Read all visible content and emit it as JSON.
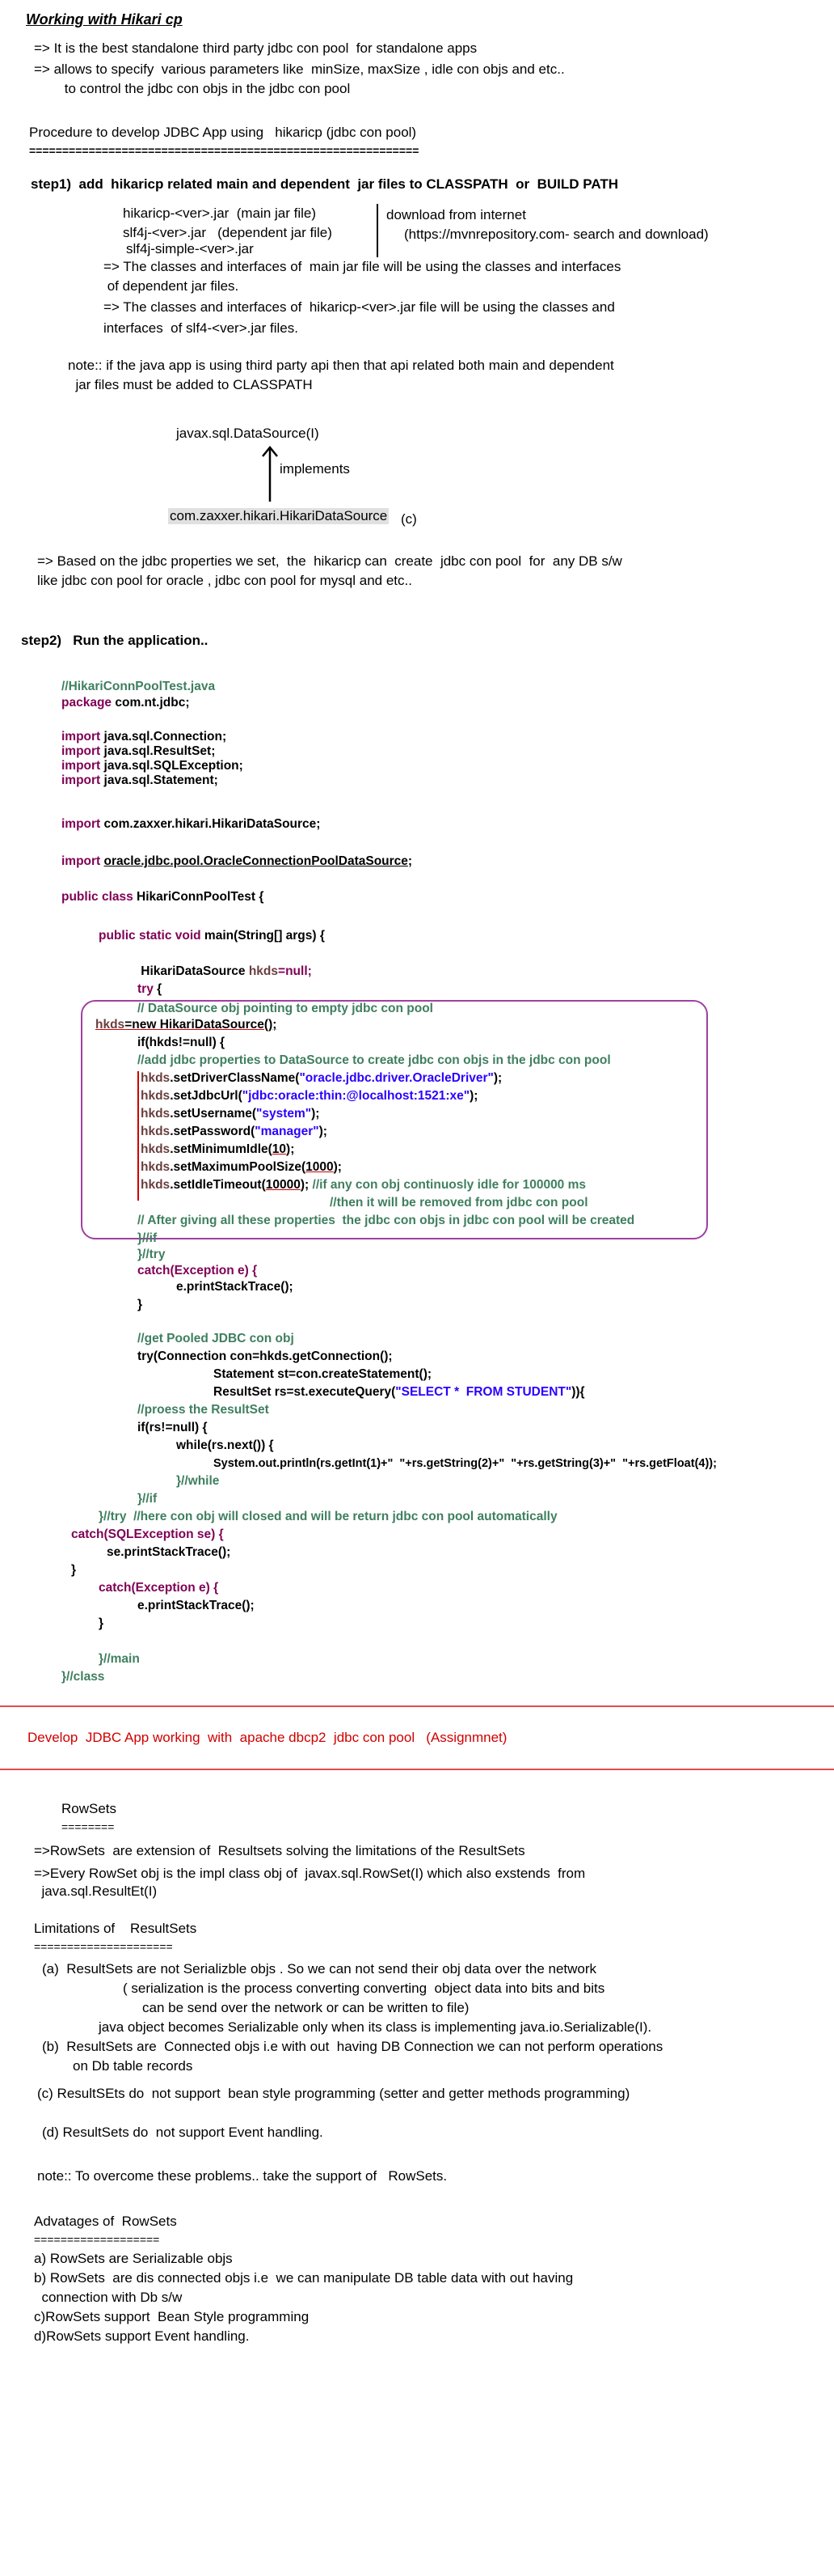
{
  "header": {
    "title": "Working with Hikari cp",
    "intro": [
      "=> It is the best standalone third party jdbc con pool  for standalone apps",
      "=> allows to specify  various parameters like  minSize, maxSize , idle con objs and etc..",
      "        to control the jdbc con objs in the jdbc con pool"
    ]
  },
  "procedure": {
    "heading": "Procedure to develop JDBC App using   hikaricp (jdbc con pool)",
    "rule": "===========================================================",
    "step1": "step1)  add  hikaricp related main and dependent  jar files to CLASSPATH  or  BUILD PATH",
    "jars": [
      "hikaricp-<ver>.jar  (main jar file)",
      "slf4j-<ver>.jar   (dependent jar file)",
      "slf4j-simple-<ver>.jar"
    ],
    "download": [
      "download from internet",
      "(https://mvnrepository.com- search and download)"
    ],
    "notes": [
      "=> The classes and interfaces of  main jar file will be using the classes and interfaces",
      " of dependent jar files.",
      "=> The classes and interfaces of  hikaricp-<ver>.jar file will be using the classes and",
      "interfaces  of slf4-<ver>.jar files."
    ],
    "note2": [
      "note:: if the java app is using third party api then that api related both main and dependent",
      "  jar files must be added to CLASSPATH"
    ],
    "diagram": {
      "interface": "javax.sql.DataSource(I)",
      "relation": "implements",
      "class": "com.zaxxer.hikari.HikariDataSource",
      "class_suffix": "(c)"
    },
    "summary": [
      "=> Based on the jdbc properties we set,  the  hikaricp can  create  jdbc con pool  for  any DB s/w",
      "like jdbc con pool for oracle , jdbc con pool for mysql and etc.."
    ],
    "step2": "step2)   Run the application.."
  },
  "code": {
    "file_comment": "//HikariConnPoolTest.java",
    "pkg_kw": "package",
    "pkg": " com.nt.jdbc;",
    "imp_kw": "import",
    "imports": [
      " java.sql.Connection;",
      " java.sql.ResultSet;",
      " java.sql.SQLException;",
      " java.sql.Statement;"
    ],
    "import_hikari": " com.zaxxer.hikari.HikariDataSource;",
    "import_oracle": "oracle.jdbc.pool.OracleConnectionPoolDataSource",
    "public_class": "public class",
    "class_name": " HikariConnPoolTest {",
    "main_kw": "public static void",
    "main_sig": " main(String[] args) {",
    "ds_type": " HikariDataSource ",
    "ds_var": "hkds",
    "eq_null": "=null;",
    "try_kw": "try",
    "brace": " {",
    "c_ds": "// DataSource obj pointing to empty jdbc con pool",
    "new_line_var": "hkds",
    "new_line_rest": "=new HikariDataSource();",
    "if_line": "if(hkds!=null) {",
    "c_add": "//add jdbc properties to DataSource to create jdbc con objs in the jdbc con pool",
    "set_driver": ".setDriverClassName(",
    "driver": "\"oracle.jdbc.driver.OracleDriver\"",
    "set_url": ".setJdbcUrl(",
    "url": "\"jdbc:oracle:thin:@localhost:1521:xe\"",
    "set_user": ".setUsername(",
    "user": "\"system\"",
    "set_pass": ".setPassword(",
    "pass": "\"manager\"",
    "set_min": ".setMinimumIdle(",
    "min": "10",
    "set_max": ".setMaximumPoolSize(",
    "max": "1000",
    "set_idle": ".setIdleTimeout(",
    "idle": "10000",
    "close_paren": ");",
    "c_idle1": " //if any con obj continuosly idle for 100000 ms",
    "c_idle2": "//then it will be removed from jdbc con pool",
    "c_after": "// After giving all these properties  the jdbc con objs in jdbc con pool will be created",
    "end_if": "}//if",
    "end_try": "}//try",
    "catch1": "catch(Exception e) {",
    "print1": "e.printStackTrace();",
    "close1": "}",
    "c_pooled": "//get Pooled JDBC con obj",
    "try2": "try(Connection con=hkds.getConnection();",
    "stmt_line": "Statement st=con.createStatement();",
    "rs_pre": "ResultSet rs=st.executeQuery(",
    "query": "\"SELECT *  FROM STUDENT\"",
    "rs_post": ")){",
    "c_process": "//proess the ResultSet",
    "if_rs": "if(rs!=null) {",
    "while_rs": "while(rs.next()) {",
    "println": "System.out.println(rs.getInt(1)+\"  \"+rs.getString(2)+\"  \"+rs.getString(3)+\"  \"+rs.getFloat(4));",
    "end_while": "}//while",
    "end_if2": "}//if",
    "end_try2": "}//try  //here con obj will closed and will be return jdbc con pool automatically",
    "catch_sql": "catch(SQLException se) {",
    "print_se": "se.printStackTrace();",
    "close2": "}",
    "catch_ex": "catch(Exception e) {",
    "print_e": "e.printStackTrace();",
    "close3": "}",
    "end_main": "}//main",
    "end_class": "}//class"
  },
  "assignment": {
    "text": "Develop  JDBC App working  with  apache dbcp2  jdbc con pool",
    "tag": "(Assignmnet)"
  },
  "rowsets": {
    "heading": "RowSets",
    "rule": "========",
    "lines": [
      "=>RowSets  are extension of  Resultsets solving the limitations of the ResultSets",
      "=>Every RowSet obj is the impl class obj of  javax.sql.RowSet(I) which also exstends  from",
      "  java.sql.ResultEt(I)"
    ],
    "limits_heading": "Limitations of    ResultSets",
    "limits_rule": "=====================",
    "limits": [
      "(a)  ResultSets are not Serializble objs . So we can not send their obj data over the network",
      "( serialization is the process converting converting  object data into bits and bits",
      "can be send over the network or can be written to file)",
      "java object becomes Serializable only when its class is implementing java.io.Serializable(I).",
      "(b)  ResultSets are  Connected objs i.e with out  having DB Connection we can not perform operations",
      "on Db table records",
      "(c) ResultSEts do  not support  bean style programming (setter and getter methods programming)",
      "(d) ResultSets do  not support Event handling.",
      "note:: To overcome these problems.. take the support of   RowSets."
    ],
    "adv_heading": "Advatages of  RowSets",
    "adv_rule": "===================",
    "advantages": [
      "a) RowSets are Serializable objs",
      "b) RowSets  are dis connected objs i.e  we can manipulate DB table data with out having",
      "  connection with Db s/w",
      "c)RowSets support  Bean Style programming",
      "d)RowSets support Event handling."
    ]
  },
  "colors": {
    "keyword": "#7f0055",
    "comment": "#3f7f5f",
    "string": "#2a00ff",
    "accent_red": "#d00000",
    "frame": "#a040a0"
  }
}
